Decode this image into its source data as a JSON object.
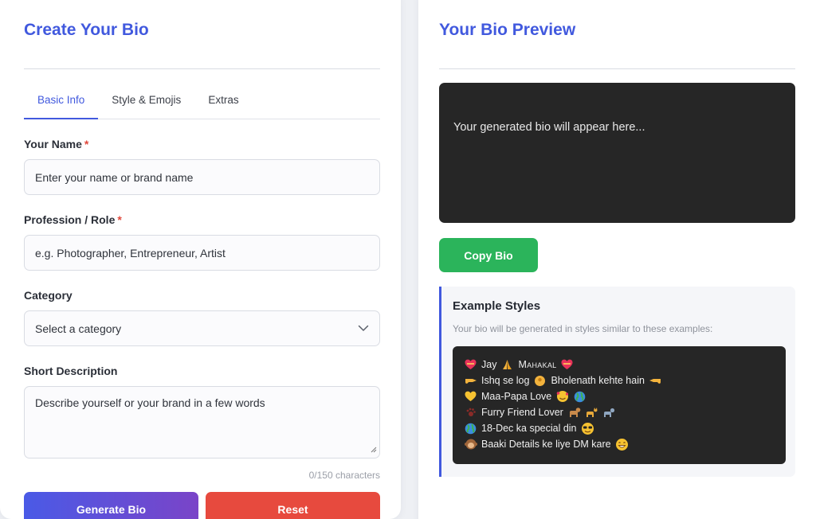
{
  "left": {
    "title": "Create Your Bio",
    "tabs": [
      {
        "label": "Basic Info",
        "active": true
      },
      {
        "label": "Style & Emojis",
        "active": false
      },
      {
        "label": "Extras",
        "active": false
      }
    ],
    "name_field": {
      "label": "Your Name",
      "required_mark": "*",
      "placeholder": "Enter your name or brand name"
    },
    "profession_field": {
      "label": "Profession / Role",
      "required_mark": "*",
      "placeholder": "e.g. Photographer, Entrepreneur, Artist"
    },
    "category_field": {
      "label": "Category",
      "selected": "Select a category"
    },
    "description_field": {
      "label": "Short Description",
      "placeholder": "Describe yourself or your brand in a few words",
      "char_count": "0/150 characters"
    },
    "generate_button": "Generate Bio",
    "reset_button": "Reset"
  },
  "right": {
    "title": "Your Bio Preview",
    "preview_placeholder": "Your generated bio will appear here...",
    "copy_button": "Copy Bio",
    "examples": {
      "title": "Example Styles",
      "subtitle": "Your bio will be generated in styles similar to these examples:",
      "lines": [
        {
          "text": "Jay",
          "mid": "Mahakal",
          "icons": [
            "heart-ribbon-icon",
            "praying-hands-icon",
            "heart-ribbon-icon"
          ]
        },
        {
          "text": "Ishq se log",
          "mid": "Bholenath kehte hain",
          "icons": [
            "pointing-right-icon",
            "om-icon",
            "pointing-left-icon"
          ]
        },
        {
          "text": "Maa-Papa Love",
          "icons": [
            "yellow-heart-icon",
            "smiling-hearts-icon",
            "globe-icon"
          ]
        },
        {
          "text": "Furry Friend Lover",
          "icons": [
            "paw-icon",
            "dog-icon",
            "cat-icon",
            "dog2-icon"
          ]
        },
        {
          "text": "18-Dec ka special din",
          "icons": [
            "globe-icon",
            "sunglasses-face-icon"
          ]
        },
        {
          "text": "Baaki Details ke liye DM kare",
          "icons": [
            "monkey-icon",
            "grin-face-icon"
          ]
        }
      ]
    }
  },
  "colors": {
    "accent": "#4159de",
    "generate_gradient": [
      "#4a5ae6",
      "#7a44c8"
    ],
    "reset": "#e74a3e",
    "copy": "#2bb45b",
    "preview_bg": "#262626"
  }
}
